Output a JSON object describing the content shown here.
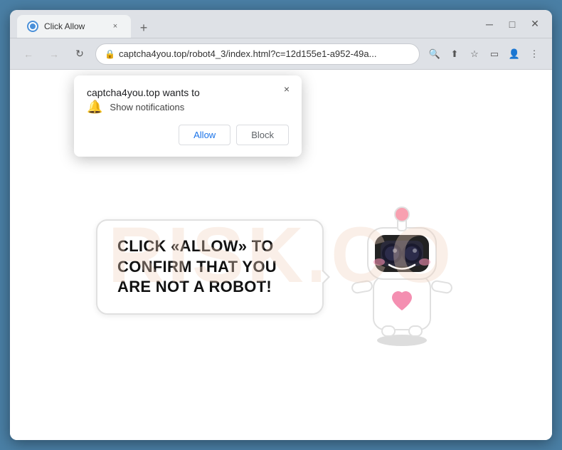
{
  "browser": {
    "title": "Click Allow",
    "tab": {
      "favicon_color": "#4a90d9",
      "title": "Click Allow",
      "close_label": "×"
    },
    "new_tab_label": "+",
    "window_controls": {
      "minimize": "─",
      "maximize": "□",
      "close": "✕"
    },
    "nav": {
      "back": "←",
      "forward": "→",
      "reload": "↻"
    },
    "url": {
      "lock_icon": "🔒",
      "text": "captcha4you.top/robot4_3/index.html?c=12d155e1-a952-49a..."
    },
    "url_actions": {
      "search": "🔍",
      "share": "⬆",
      "bookmark": "☆",
      "reader": "▭",
      "account": "👤",
      "menu": "⋮"
    }
  },
  "popup": {
    "title": "captcha4you.top wants to",
    "close_label": "×",
    "permission": {
      "icon": "🔔",
      "text": "Show notifications"
    },
    "buttons": {
      "allow": "Allow",
      "block": "Block"
    }
  },
  "page": {
    "main_text": "CLICK «ALLOW» TO CONFIRM THAT YOU ARE NOT A ROBOT!",
    "watermark": "RISK.CO"
  }
}
